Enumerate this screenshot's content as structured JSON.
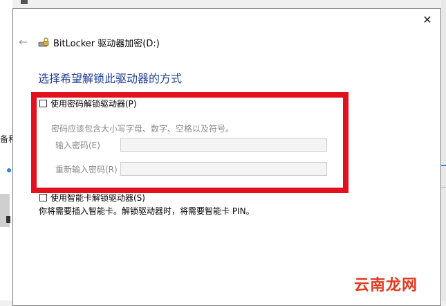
{
  "background": {
    "left_text": "备和"
  },
  "dialog": {
    "title": "BitLocker 驱动器加密(D:)",
    "close_glyph": "✕",
    "back_glyph": "←",
    "heading": "选择希望解锁此驱动器的方式",
    "password_option": {
      "label": "使用密码解锁驱动器(P)",
      "checked": false,
      "hint": "密码应该包含大小写字母、数字、空格以及符号。",
      "enter_label": "输入密码(E)",
      "reenter_label": "重新输入密码(R)",
      "enter_value": "",
      "reenter_value": ""
    },
    "smartcard_option": {
      "label": "使用智能卡解锁驱动器(S)",
      "checked": false,
      "description": "你将需要插入智能卡。解锁驱动器时，将需要智能卡 PIN。"
    }
  },
  "watermark": "云南龙网",
  "colors": {
    "highlight": "#e3101e",
    "heading": "#1f3f99",
    "watermark": "#e23a21"
  }
}
